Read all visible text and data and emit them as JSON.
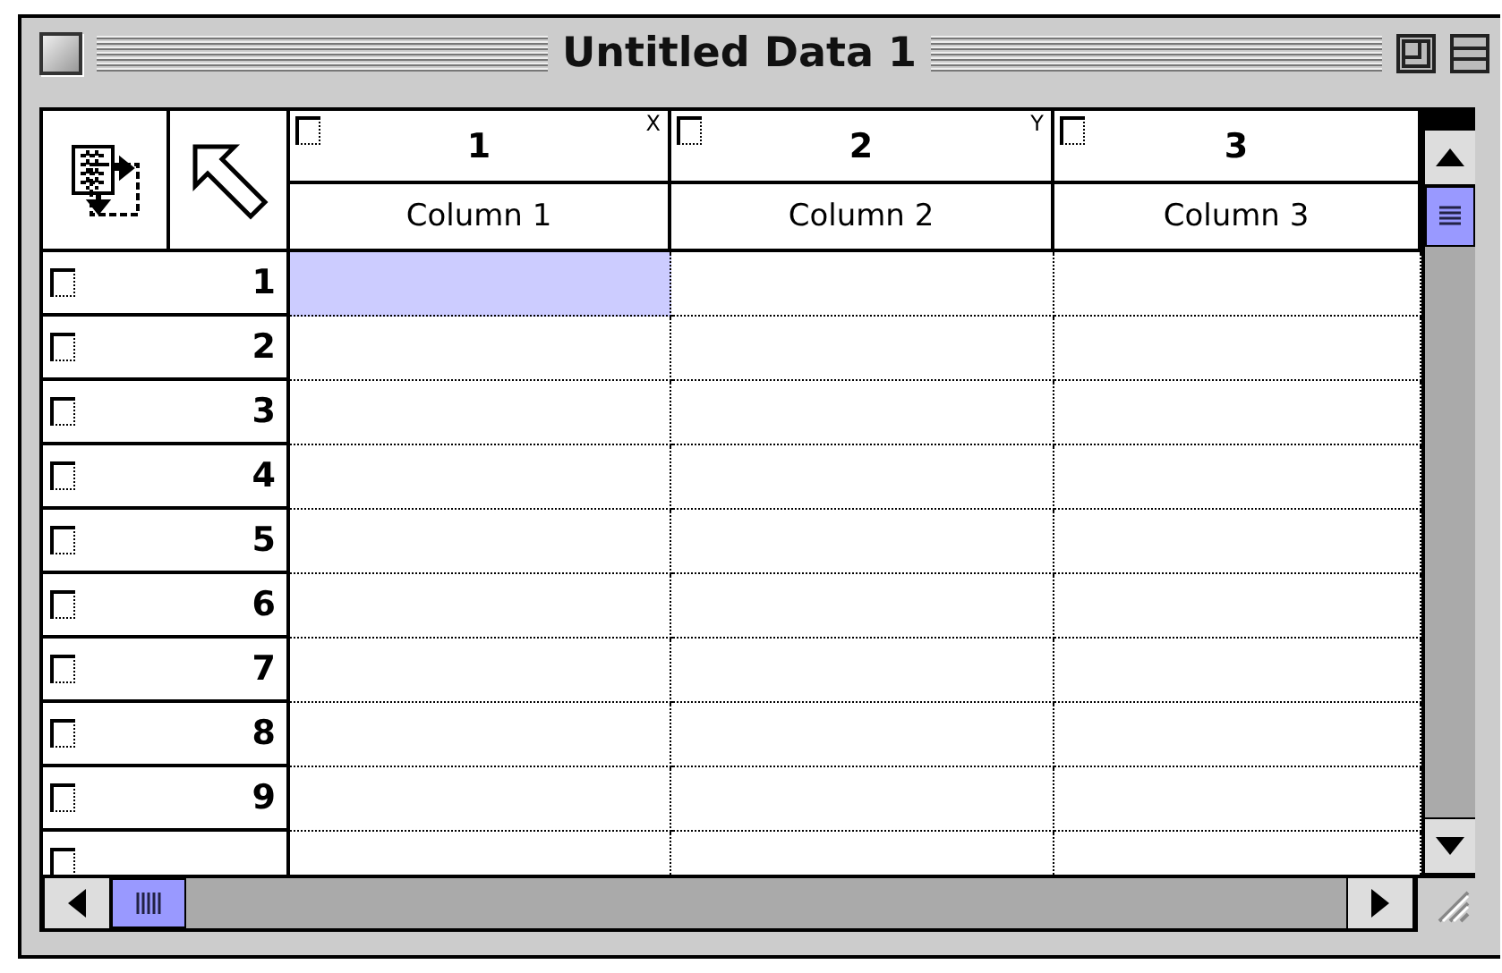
{
  "window": {
    "title": "Untitled Data 1"
  },
  "columns": [
    {
      "number": "1",
      "axis": "X",
      "name": "Column 1",
      "checked": false
    },
    {
      "number": "2",
      "axis": "Y",
      "name": "Column 2",
      "checked": false
    },
    {
      "number": "3",
      "name": "Column 3",
      "checked": false
    }
  ],
  "rows": [
    {
      "label": "1",
      "checked": false,
      "cells": [
        {
          "selected": true
        },
        {
          "selected": false
        },
        {
          "selected": false
        }
      ]
    },
    {
      "label": "2",
      "checked": false,
      "cells": [
        {
          "selected": false
        },
        {
          "selected": false
        },
        {
          "selected": false
        }
      ]
    },
    {
      "label": "3",
      "checked": false,
      "cells": [
        {
          "selected": false
        },
        {
          "selected": false
        },
        {
          "selected": false
        }
      ]
    },
    {
      "label": "4",
      "checked": false,
      "cells": [
        {
          "selected": false
        },
        {
          "selected": false
        },
        {
          "selected": false
        }
      ]
    },
    {
      "label": "5",
      "checked": false,
      "cells": [
        {
          "selected": false
        },
        {
          "selected": false
        },
        {
          "selected": false
        }
      ]
    },
    {
      "label": "6",
      "checked": false,
      "cells": [
        {
          "selected": false
        },
        {
          "selected": false
        },
        {
          "selected": false
        }
      ]
    },
    {
      "label": "7",
      "checked": false,
      "cells": [
        {
          "selected": false
        },
        {
          "selected": false
        },
        {
          "selected": false
        }
      ]
    },
    {
      "label": "8",
      "checked": false,
      "cells": [
        {
          "selected": false
        },
        {
          "selected": false
        },
        {
          "selected": false
        }
      ]
    },
    {
      "label": "9",
      "checked": false,
      "cells": [
        {
          "selected": false
        },
        {
          "selected": false
        },
        {
          "selected": false
        }
      ]
    },
    {
      "checked": false,
      "cells": [
        {
          "selected": false
        },
        {
          "selected": false
        },
        {
          "selected": false
        }
      ]
    }
  ]
}
